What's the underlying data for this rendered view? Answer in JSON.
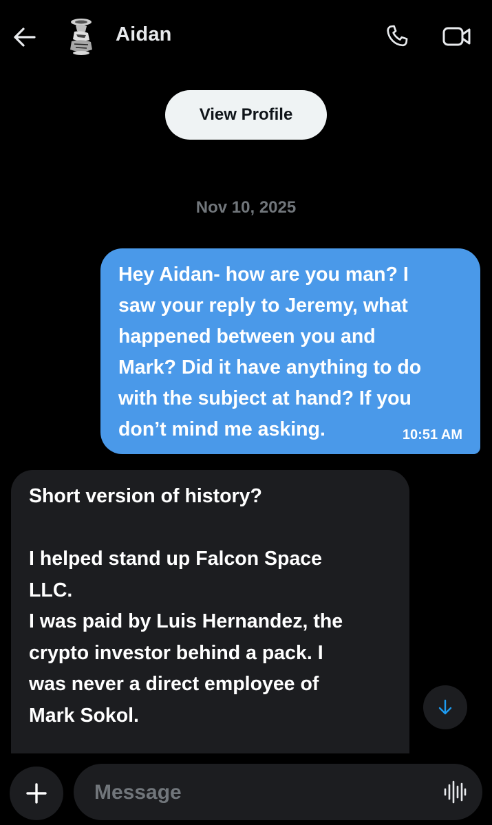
{
  "header": {
    "contact_name": "Aidan",
    "back_icon": "arrow-left-icon",
    "avatar_icon": "avatar-image",
    "call_icon": "phone-icon",
    "video_icon": "video-camera-icon"
  },
  "profile": {
    "view_profile_label": "View Profile"
  },
  "conversation": {
    "date_label": "Nov 10, 2025",
    "messages": [
      {
        "direction": "sent",
        "text": "Hey Aidan- how are you man? I\nsaw your reply to Jeremy, what\nhappened between you and\nMark? Did it have anything to do\nwith the subject at hand? If you\ndon’t mind me asking.",
        "time": "10:51 AM"
      },
      {
        "direction": "received",
        "text": "Short version of history?\n\nI helped stand up Falcon Space\nLLC.\nI was paid by Luis Hernandez, the\ncrypto investor behind a pack. I\nwas never a direct employee of\nMark Sokol."
      }
    ],
    "scroll_down_icon": "arrow-down-icon"
  },
  "composer": {
    "add_icon": "plus-icon",
    "placeholder": "Message",
    "value": "",
    "voice_icon": "voice-waveform-icon"
  },
  "colors": {
    "background": "#000000",
    "sent_bubble": "#4a99e9",
    "received_bubble": "#1c1d20",
    "muted_text": "#71767b",
    "accent": "#1d9bf0",
    "button_light": "#eff3f4"
  }
}
